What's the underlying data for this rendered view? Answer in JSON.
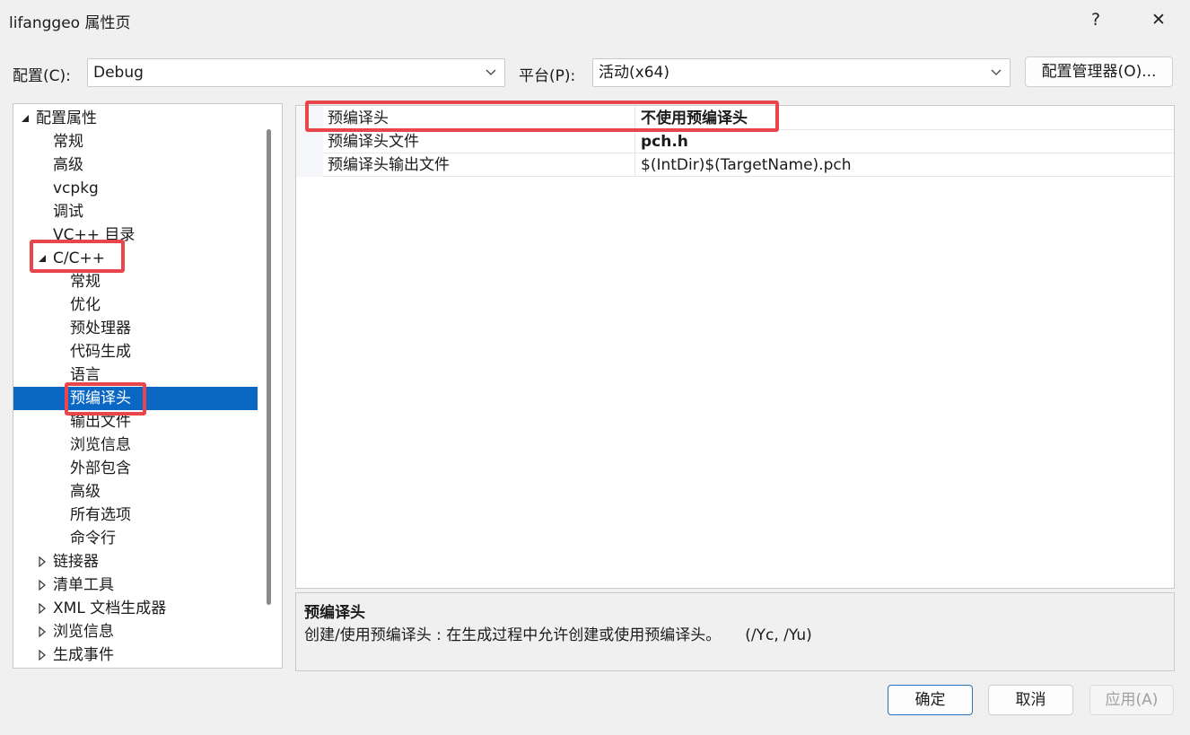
{
  "window": {
    "title": "lifanggeo 属性页",
    "help": "?",
    "close": "✕"
  },
  "config_row": {
    "config_label": "配置(C):",
    "config_value": "Debug",
    "platform_label": "平台(P):",
    "platform_value": "活动(x64)",
    "manager_button": "配置管理器(O)..."
  },
  "tree": {
    "items": [
      {
        "label": "配置属性",
        "expander": "expanded"
      },
      {
        "label": "常规"
      },
      {
        "label": "高级"
      },
      {
        "label": "vcpkg"
      },
      {
        "label": "调试"
      },
      {
        "label": "VC++ 目录"
      },
      {
        "label": "C/C++",
        "expander": "expanded"
      },
      {
        "label": "常规"
      },
      {
        "label": "优化"
      },
      {
        "label": "预处理器"
      },
      {
        "label": "代码生成"
      },
      {
        "label": "语言"
      },
      {
        "label": "预编译头",
        "selected": true
      },
      {
        "label": "输出文件"
      },
      {
        "label": "浏览信息"
      },
      {
        "label": "外部包含"
      },
      {
        "label": "高级"
      },
      {
        "label": "所有选项"
      },
      {
        "label": "命令行"
      },
      {
        "label": "链接器",
        "expander": "collapsed"
      },
      {
        "label": "清单工具",
        "expander": "collapsed"
      },
      {
        "label": "XML 文档生成器",
        "expander": "collapsed"
      },
      {
        "label": "浏览信息",
        "expander": "collapsed"
      },
      {
        "label": "生成事件",
        "expander": "collapsed"
      }
    ]
  },
  "grid": {
    "rows": [
      {
        "name": "预编译头",
        "value": "不使用预编译头",
        "bold": true
      },
      {
        "name": "预编译头文件",
        "value": "pch.h",
        "bold": true
      },
      {
        "name": "预编译头输出文件",
        "value": "$(IntDir)$(TargetName).pch",
        "bold": false
      }
    ]
  },
  "description": {
    "title": "预编译头",
    "text": "创建/使用预编译头 : 在生成过程中允许创建或使用预编译头。     (/Yc, /Yu)"
  },
  "footer": {
    "ok": "确定",
    "cancel": "取消",
    "apply": "应用(A)"
  },
  "colors": {
    "selection": "#0a67c4",
    "highlight": "#e8464a"
  }
}
